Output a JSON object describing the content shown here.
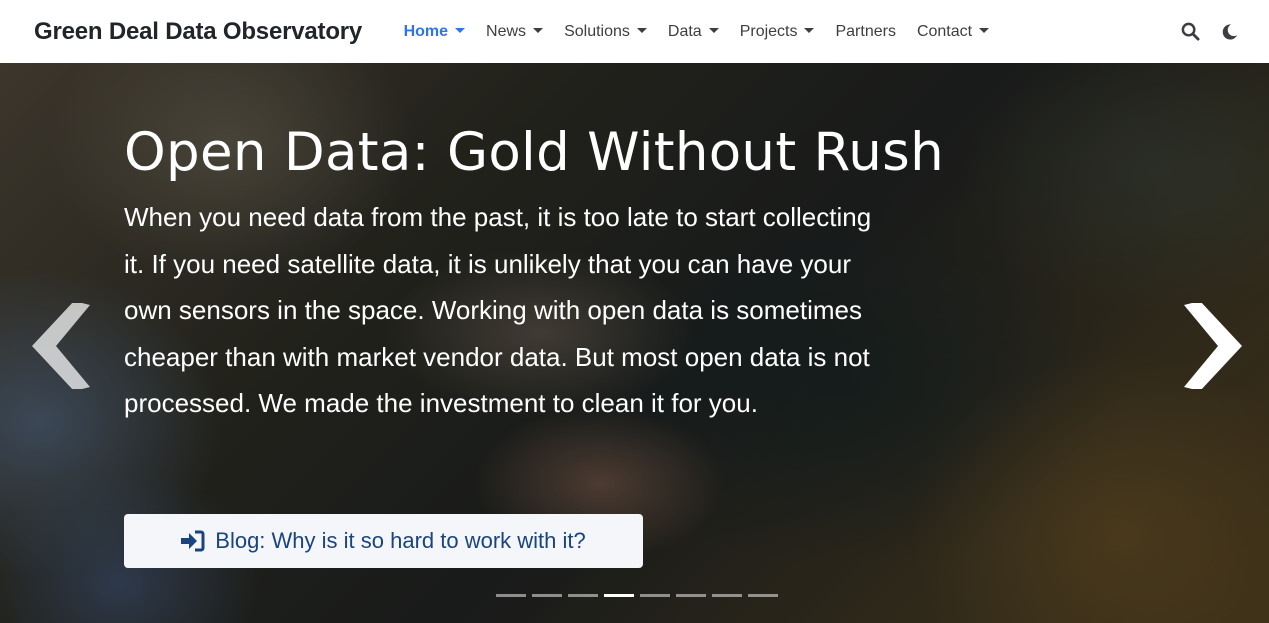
{
  "navbar": {
    "brand": "Green Deal Data Observatory",
    "items": [
      {
        "label": "Home",
        "active": true,
        "dropdown": true
      },
      {
        "label": "News",
        "active": false,
        "dropdown": true
      },
      {
        "label": "Solutions",
        "active": false,
        "dropdown": true
      },
      {
        "label": "Data",
        "active": false,
        "dropdown": true
      },
      {
        "label": "Projects",
        "active": false,
        "dropdown": true
      },
      {
        "label": "Partners",
        "active": false,
        "dropdown": false
      },
      {
        "label": "Contact",
        "active": false,
        "dropdown": true
      }
    ],
    "tools": {
      "search_icon": "search-icon",
      "theme_icon": "moon-icon"
    },
    "accent_color": "#2f74e8"
  },
  "hero": {
    "title": "Open Data: Gold Without Rush",
    "text": "When you need data from the past, it is too late to start collecting it. If you need satellite data, it is unlikely that you can have your own sensors in the space. Working with open data is sometimes cheaper than with market vendor data. But most open data is not processed. We made the investment to clean it for you.",
    "button": {
      "label": "Blog: Why is it so hard to work with it?",
      "icon": "sign-in-icon",
      "text_color": "#1a4480"
    },
    "prev_icon": "chevron-left-icon",
    "next_icon": "chevron-right-icon",
    "slides": {
      "count": 8,
      "active_index": 3
    }
  }
}
